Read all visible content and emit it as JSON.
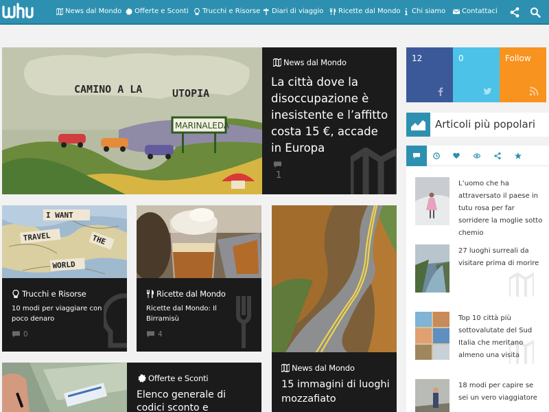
{
  "brand": {
    "logo_text": "wuhu",
    "accent": "#2e90b1"
  },
  "nav": {
    "items": [
      {
        "label": "News dal Mondo",
        "icon": "map-icon"
      },
      {
        "label": "Offerte e Sconti",
        "icon": "badge-icon"
      },
      {
        "label": "Trucchi e Risorse",
        "icon": "lightbulb-icon"
      },
      {
        "label": "Diari di viaggio",
        "icon": "signpost-icon"
      },
      {
        "label": "Ricette dal Mondo",
        "icon": "fork-knife-icon"
      },
      {
        "label": "Chi siamo",
        "icon": "info-icon"
      },
      {
        "label": "Contattaci",
        "icon": "envelope-icon"
      }
    ],
    "tools": [
      "share-icon",
      "search-icon"
    ]
  },
  "feature": {
    "category": "News dal Mondo",
    "title": "La città dove la disoccupazione è inesistente e l’affitto costa 15 €, accade in Europa",
    "comments": "1",
    "image_text": {
      "line1": "CAMINO A LA",
      "line2": "UTOPIA",
      "sign": "MARINALEDA"
    }
  },
  "cards": [
    {
      "category": "Trucchi e Risorse",
      "title": "10 modi per viaggiare con poco denaro",
      "comments": "0",
      "image_words": [
        "I WANT",
        "TRAVEL",
        "THE",
        "WORLD"
      ]
    },
    {
      "category": "Ricette dal Mondo",
      "title": "Ricette dal Mondo: Il Birramisù",
      "comments": "4"
    },
    {
      "category": "News dal Mondo",
      "title": "15 immagini di luoghi mozzafiato"
    },
    {
      "category": "Offerte e Sconti",
      "title": "Elenco generale di codici sconto e promozioni valido"
    }
  ],
  "social": [
    {
      "count": "12",
      "network": "facebook",
      "color": "#3b5998"
    },
    {
      "count": "0",
      "network": "twitter",
      "color": "#4cc2e8"
    },
    {
      "count": "Follow",
      "network": "rss",
      "color": "#f7931e"
    }
  ],
  "popular": {
    "title": "Articoli più popolari",
    "tabs": [
      "comment-icon",
      "clock-icon",
      "heart-icon",
      "eye-icon",
      "share-icon",
      "star-icon"
    ],
    "items": [
      {
        "title": "L’uomo che ha attraversato il paese in tutu rosa per far sorridere la moglie sotto chemio"
      },
      {
        "title": "27 luoghi surreali da visitare prima di morire"
      },
      {
        "title": "Top 10 città più sottovalutate del Sud Italia che meritano almeno una visita"
      },
      {
        "title": "18 modi per capire se sei un vero viaggiatore"
      }
    ]
  }
}
